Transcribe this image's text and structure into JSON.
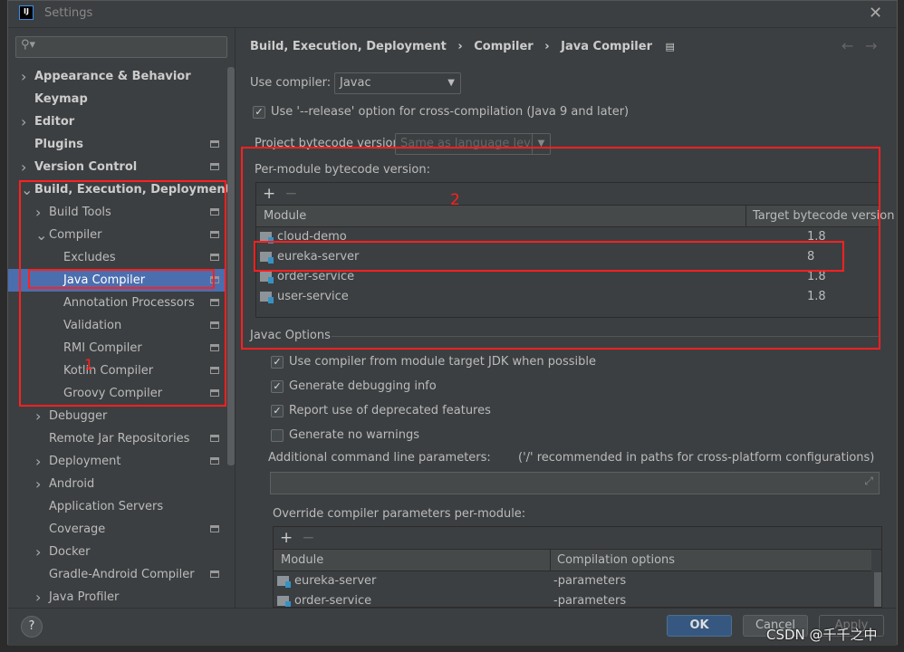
{
  "window": {
    "title": "Settings",
    "logo": "IJ"
  },
  "sidebar": {
    "search_placeholder": "",
    "items": [
      {
        "label": "Appearance & Behavior",
        "bold": true,
        "chevron": ">"
      },
      {
        "label": "Keymap",
        "bold": true
      },
      {
        "label": "Editor",
        "bold": true,
        "chevron": ">"
      },
      {
        "label": "Plugins",
        "bold": true,
        "page": true
      },
      {
        "label": "Version Control",
        "bold": true,
        "chevron": ">",
        "page": true
      },
      {
        "label": "Build, Execution, Deployment",
        "bold": true,
        "chevron": "v"
      },
      {
        "label": "Build Tools",
        "chevron": ">",
        "page": true
      },
      {
        "label": "Compiler",
        "chevron": "v",
        "page": true
      },
      {
        "label": "Excludes",
        "page": true
      },
      {
        "label": "Java Compiler",
        "page": true,
        "selected": true
      },
      {
        "label": "Annotation Processors",
        "page": true
      },
      {
        "label": "Validation",
        "page": true
      },
      {
        "label": "RMI Compiler",
        "page": true
      },
      {
        "label": "Kotlin Compiler",
        "page": true
      },
      {
        "label": "Groovy Compiler",
        "page": true
      },
      {
        "label": "Debugger",
        "chevron": ">"
      },
      {
        "label": "Remote Jar Repositories",
        "page": true
      },
      {
        "label": "Deployment",
        "chevron": ">",
        "page": true
      },
      {
        "label": "Android",
        "chevron": ">"
      },
      {
        "label": "Application Servers"
      },
      {
        "label": "Coverage",
        "page": true
      },
      {
        "label": "Docker",
        "chevron": ">"
      },
      {
        "label": "Gradle-Android Compiler",
        "page": true
      },
      {
        "label": "Java Profiler",
        "chevron": ">"
      }
    ]
  },
  "breadcrumb": [
    "Build, Execution, Deployment",
    "Compiler",
    "Java Compiler"
  ],
  "use_compiler": {
    "label": "Use compiler:",
    "value": "Javac"
  },
  "release_option": {
    "label": "Use '--release' option for cross-compilation (Java 9 and later)",
    "checked": true
  },
  "project_bytecode": {
    "label": "Project bytecode version:",
    "value": "Same as language level"
  },
  "per_module": {
    "label": "Per-module bytecode version:",
    "columns": [
      "Module",
      "Target bytecode version"
    ],
    "rows": [
      {
        "module": "cloud-demo",
        "version": "1.8"
      },
      {
        "module": "eureka-server",
        "version": "8"
      },
      {
        "module": "order-service",
        "version": "1.8"
      },
      {
        "module": "user-service",
        "version": "1.8"
      }
    ]
  },
  "javac_options": {
    "title": "Javac Options",
    "checks": [
      {
        "label": "Use compiler from module target JDK when possible",
        "checked": true
      },
      {
        "label": "Generate debugging info",
        "checked": true
      },
      {
        "label": "Report use of deprecated features",
        "checked": true
      },
      {
        "label": "Generate no warnings",
        "checked": false
      }
    ],
    "additional_label": "Additional command line parameters:",
    "additional_hint": "('/' recommended in paths for cross-platform configurations)",
    "additional_value": ""
  },
  "override": {
    "label": "Override compiler parameters per-module:",
    "columns": [
      "Module",
      "Compilation options"
    ],
    "rows": [
      {
        "module": "eureka-server",
        "options": "-parameters"
      },
      {
        "module": "order-service",
        "options": "-parameters"
      }
    ]
  },
  "annotations": {
    "box1": "1",
    "box2": "2",
    "color": "#ff2020"
  },
  "buttons": {
    "help": "?",
    "ok": "OK",
    "cancel": "Cancel",
    "apply": "Apply"
  },
  "watermark": "CSDN @千千之中"
}
